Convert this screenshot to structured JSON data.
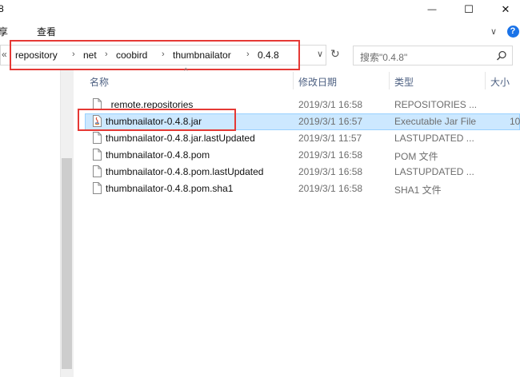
{
  "window": {
    "title_fragment": "8",
    "minimize_glyph": "—",
    "maximize_glyph": "☐",
    "close_glyph": "✕"
  },
  "ribbon": {
    "tabs": [
      "共享",
      "查看"
    ],
    "tab_share_visible": "享",
    "expand_glyph": "∨",
    "help_glyph": "?"
  },
  "address": {
    "back_glyph": "«",
    "breadcrumbs": [
      "repository",
      "net",
      "coobird",
      "thumbnailator",
      "0.4.8"
    ],
    "separator": "›",
    "dropdown_glyph": "∨",
    "refresh_glyph": "↻",
    "highlight_color": "#e53935"
  },
  "search": {
    "placeholder": "搜索\"0.4.8\""
  },
  "columns": {
    "name": "名称",
    "modified": "修改日期",
    "type": "类型",
    "size": "大小"
  },
  "files": [
    {
      "name": "_remote.repositories",
      "modified": "2019/3/1 16:58",
      "type": "REPOSITORIES ...",
      "size": "",
      "icon": "document-icon"
    },
    {
      "name": "thumbnailator-0.4.8.jar",
      "modified": "2019/3/1 16:57",
      "type": "Executable Jar File",
      "size": "10",
      "icon": "java-jar-icon",
      "selected": true
    },
    {
      "name": "thumbnailator-0.4.8.jar.lastUpdated",
      "modified": "2019/3/1 11:57",
      "type": "LASTUPDATED ...",
      "size": "",
      "icon": "document-icon"
    },
    {
      "name": "thumbnailator-0.4.8.pom",
      "modified": "2019/3/1 16:58",
      "type": "POM 文件",
      "size": "",
      "icon": "document-icon"
    },
    {
      "name": "thumbnailator-0.4.8.pom.lastUpdated",
      "modified": "2019/3/1 16:58",
      "type": "LASTUPDATED ...",
      "size": "",
      "icon": "document-icon"
    },
    {
      "name": "thumbnailator-0.4.8.pom.sha1",
      "modified": "2019/3/1 16:58",
      "type": "SHA1 文件",
      "size": "",
      "icon": "document-icon"
    }
  ],
  "colors": {
    "selection_bg": "#cce8ff",
    "selection_border": "#99d1ff",
    "header_text": "#4d6082",
    "help_blue": "#1a73e8"
  }
}
